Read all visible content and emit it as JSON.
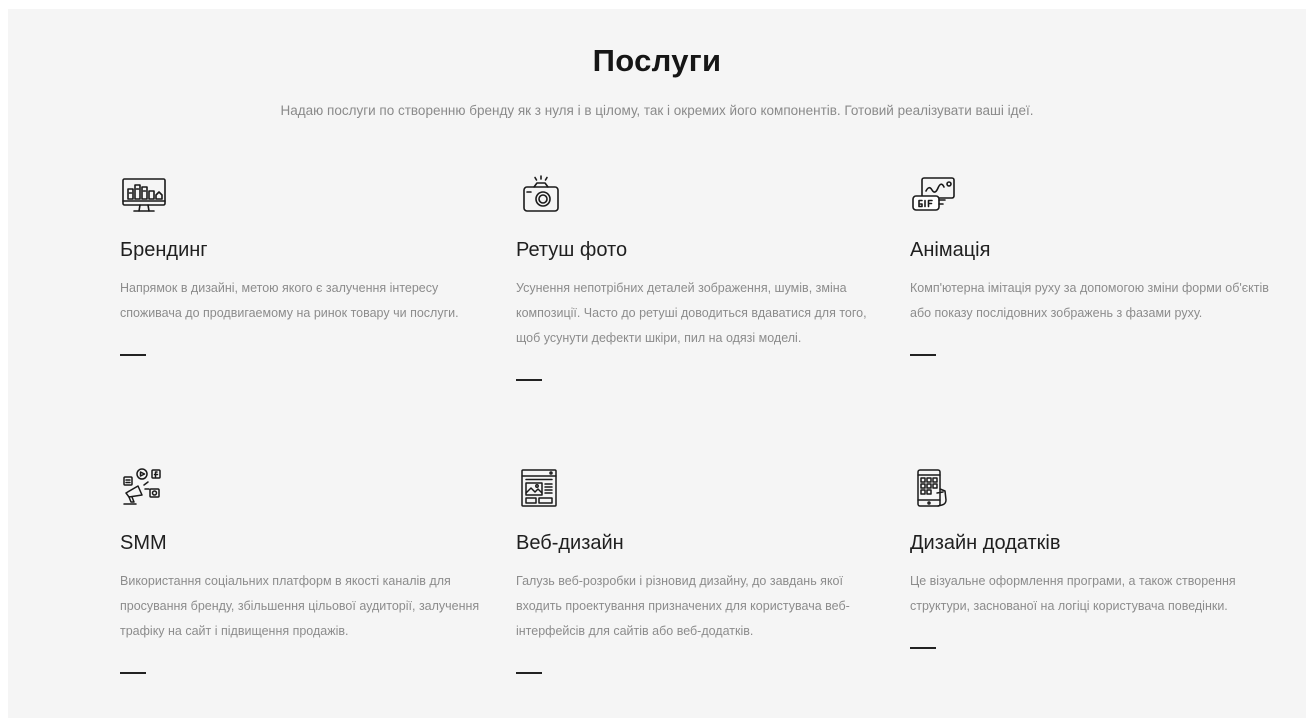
{
  "services": {
    "title": "Послуги",
    "subtitle": "Надаю послуги по створенню бренду як з нуля і в цілому, так і окремих його компонентів. Готовий реалізувати ваші ідеї.",
    "items": [
      {
        "icon": "branding-monitor-icon",
        "title": "Брендинг",
        "description": "Напрямок в дизайні, метою якого є залучення інтересу споживача до продвигаемому на ринок товару чи послуги."
      },
      {
        "icon": "camera-icon",
        "title": "Ретуш фото",
        "description": "Усунення непотрібних деталей зображення, шумів, зміна композиції. Часто до ретуші доводиться вдаватися для того, щоб усунути дефекти шкіри, пил на одязі моделі."
      },
      {
        "icon": "gif-animation-icon",
        "title": "Анімація",
        "description": "Комп'ютерна імітація руху за допомогою зміни форми об'єктів або показу послідовних зображень з фазами руху."
      },
      {
        "icon": "smm-megaphone-icon",
        "title": "SMM",
        "description": "Використання соціальних платформ в якості каналів для просування бренду, збільшення цільової аудиторії, залучення трафіку на сайт і підвищення продажів."
      },
      {
        "icon": "web-design-icon",
        "title": "Веб-дизайн",
        "description": "Галузь веб-розробки і різновид дизайну, до завдань якої входить проектування призначених для користувача веб-інтерфейсів для сайтів або веб-додатків."
      },
      {
        "icon": "mobile-app-icon",
        "title": "Дизайн додатків",
        "description": "Це візуальне оформлення програми, а також створення структури, заснованої на логіці користувача поведінки."
      }
    ]
  }
}
